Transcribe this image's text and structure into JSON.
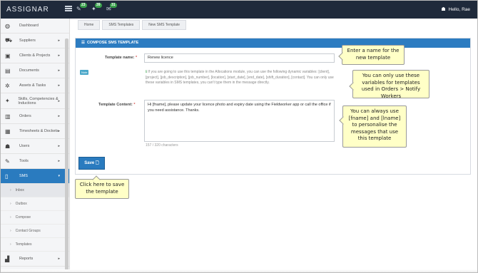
{
  "topbar": {
    "logo": "ASSIGNAR",
    "badges": [
      "23",
      "39",
      "31"
    ],
    "user": "Hello, Rae"
  },
  "sidebar": {
    "items": [
      {
        "label": "Dashboard",
        "icon": "dashboard-icon",
        "glyph": "◍",
        "arrow": ""
      },
      {
        "label": "Suppliers",
        "icon": "truck-icon",
        "glyph": "⛟",
        "arrow": "▸"
      },
      {
        "label": "Clients & Projects",
        "icon": "briefcase-icon",
        "glyph": "▣",
        "arrow": "▸"
      },
      {
        "label": "Documents",
        "icon": "document-icon",
        "glyph": "▤",
        "arrow": "▸"
      },
      {
        "label": "Assets & Tasks",
        "icon": "cogs-icon",
        "glyph": "✲",
        "arrow": "▸"
      },
      {
        "label": "Skills, Competencies & Inductions",
        "icon": "certificate-icon",
        "glyph": "✦",
        "arrow": "▸"
      },
      {
        "label": "Orders",
        "icon": "orders-icon",
        "glyph": "▥",
        "arrow": "▸"
      },
      {
        "label": "Timesheets & Dockets",
        "icon": "table-icon",
        "glyph": "▦",
        "arrow": "▸"
      },
      {
        "label": "Users",
        "icon": "users-icon",
        "glyph": "☗",
        "arrow": "▸"
      },
      {
        "label": "Tools",
        "icon": "wrench-icon",
        "glyph": "✎",
        "arrow": "▸"
      },
      {
        "label": "SMS",
        "icon": "mobile-icon",
        "glyph": "▯",
        "arrow": "▾"
      }
    ],
    "sms_sub": [
      "Inbox",
      "Outbox",
      "Compose",
      "Contact Groups",
      "Templates"
    ],
    "reports": {
      "label": "Reports",
      "icon": "chart-icon",
      "glyph": "▟",
      "arrow": "▸"
    }
  },
  "breadcrumb": [
    "Home",
    "SMS Templates",
    "New SMS Template"
  ],
  "panel": {
    "title": "COMPOSE SMS TEMPLATE",
    "name_label": "Template name:",
    "name_value": "Renew licence",
    "note_tag": "Note",
    "help_text": "If you are going to use this template in the Allocations module, you can use the following dynamic variables: [client], [project], [job_description], [job_number], [location], [start_date], [end_date], [shift_duration], [contact]. You can only use these variables in SMS templates, you can't type them in the message directly.",
    "content_label": "Template Content:",
    "content_value": "Hi [fname], please update your licence photo and expiry date using the Fieldworker app or call the office if you need assistance. Thanks.",
    "counter": "157 / 320 characters",
    "save_label": "Save 🗋",
    "required": "*"
  },
  "callouts": {
    "name": "Enter a name for the new template",
    "vars": "You can only use these variables for templates used in Orders > Notify Workers",
    "fname": "You can always use [fname] and [lname] to personalise the messages that use this template",
    "save": "Click here to save the template"
  },
  "colors": {
    "accent": "#2a7bbf",
    "topbar": "#1f2a3b",
    "callout": "#ffffc7"
  }
}
